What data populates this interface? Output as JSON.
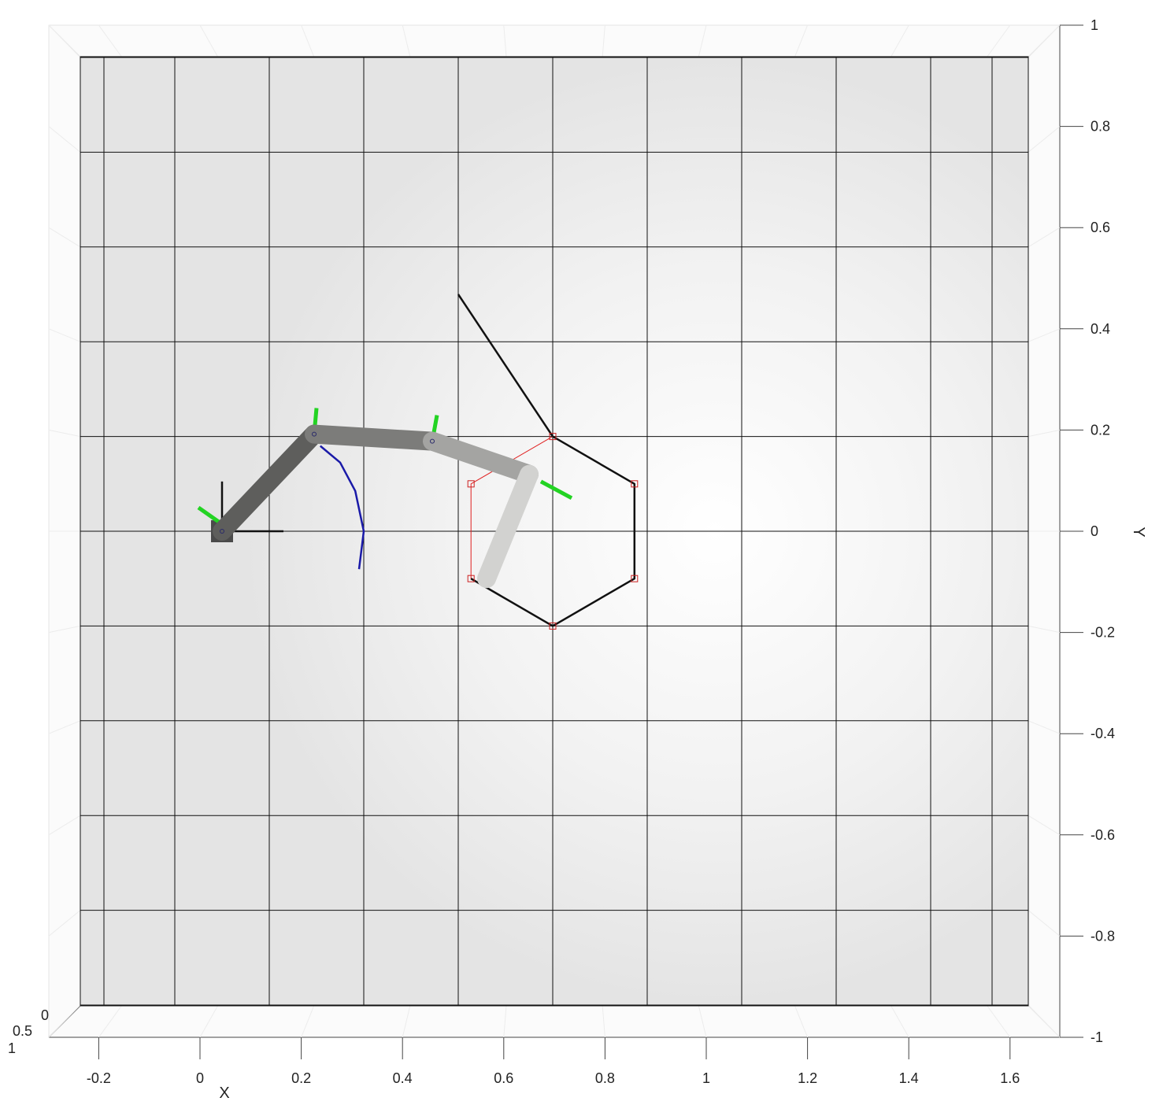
{
  "chart_data": {
    "type": "3d-robot-arm-plot",
    "view": "top-down",
    "grid": true,
    "xlabel": "X",
    "ylabel": "Y",
    "xlim": [
      -0.28,
      1.7
    ],
    "ylim": [
      -1,
      1
    ],
    "x_ticks": [
      -0.2,
      0,
      0.2,
      0.4,
      0.6,
      0.8,
      1,
      1.2,
      1.4,
      1.6
    ],
    "x_tick_labels": [
      "-0.2",
      "0",
      "0.2",
      "0.4",
      "0.6",
      "0.8",
      "1",
      "1.2",
      "1.4",
      "1.6"
    ],
    "y_ticks": [
      1,
      0.8,
      0.6,
      0.4,
      0.2,
      0,
      -0.2,
      -0.4,
      -0.6,
      -0.8,
      -1
    ],
    "y_tick_labels": [
      "1",
      "0.8",
      "0.6",
      "0.4",
      "0.2",
      "0",
      "-0.2",
      "-0.4",
      "-0.6",
      "-0.8",
      "-1"
    ],
    "z_tick_labels": [
      "0",
      "0.5",
      "1"
    ],
    "floor_grid": {
      "x_lines": [
        -0.25,
        -0.1,
        0.1,
        0.3,
        0.5,
        0.7,
        0.9,
        1.1,
        1.3,
        1.5,
        1.63
      ],
      "y_lines": [
        1,
        0.8,
        0.6,
        0.4,
        0.2,
        0,
        -0.2,
        -0.4,
        -0.6,
        -0.8,
        -1
      ]
    },
    "series": [
      {
        "type": "polyline",
        "points": [
          [
            0.7,
            0.2
          ],
          [
            0.873,
            0.1
          ],
          [
            0.873,
            -0.1
          ],
          [
            0.7,
            -0.2
          ],
          [
            0.527,
            -0.1
          ],
          [
            0.527,
            0.1
          ],
          [
            0.7,
            0.2
          ]
        ],
        "color": "#e02020"
      },
      {
        "type": "polyline",
        "points": [
          [
            0.7,
            0.2
          ],
          [
            0.873,
            0.1
          ],
          [
            0.873,
            -0.1
          ],
          [
            0.7,
            -0.2
          ],
          [
            0.527,
            -0.1
          ]
        ],
        "color": "#111111"
      },
      {
        "type": "line",
        "points": [
          [
            0.5,
            0.5
          ],
          [
            0.7,
            0.2
          ]
        ],
        "color": "#111111"
      },
      {
        "type": "arc",
        "points": [
          [
            0.208,
            0.18
          ],
          [
            0.25,
            0.145
          ],
          [
            0.282,
            0.085
          ],
          [
            0.3,
            0.0
          ],
          [
            0.29,
            -0.08
          ]
        ],
        "color": "#1a1aa8"
      },
      {
        "type": "robot-links",
        "joints": [
          [
            0.0,
            0.0
          ],
          [
            0.195,
            0.205
          ],
          [
            0.445,
            0.19
          ],
          [
            0.65,
            0.12
          ],
          [
            0.56,
            -0.1
          ]
        ],
        "color_start": "#5a5a58",
        "color_end": "#ececec"
      }
    ],
    "waypoints": [
      [
        0.7,
        0.2
      ],
      [
        0.873,
        0.1
      ],
      [
        0.873,
        -0.1
      ],
      [
        0.7,
        -0.2
      ],
      [
        0.527,
        -0.1
      ],
      [
        0.527,
        0.1
      ]
    ],
    "joint_axes": [
      {
        "from": [
          0.195,
          0.205
        ],
        "to": [
          0.2,
          0.26
        ]
      },
      {
        "from": [
          0.445,
          0.19
        ],
        "to": [
          0.455,
          0.245
        ]
      },
      {
        "from": [
          0.675,
          0.105
        ],
        "to": [
          0.74,
          0.07
        ]
      },
      {
        "from": [
          -0.05,
          0.05
        ],
        "to": [
          0.0,
          0.015
        ]
      }
    ],
    "base_frame": {
      "x_axis_to": [
        0.13,
        0.0
      ],
      "y_axis_to": [
        0.0,
        0.105
      ]
    }
  }
}
